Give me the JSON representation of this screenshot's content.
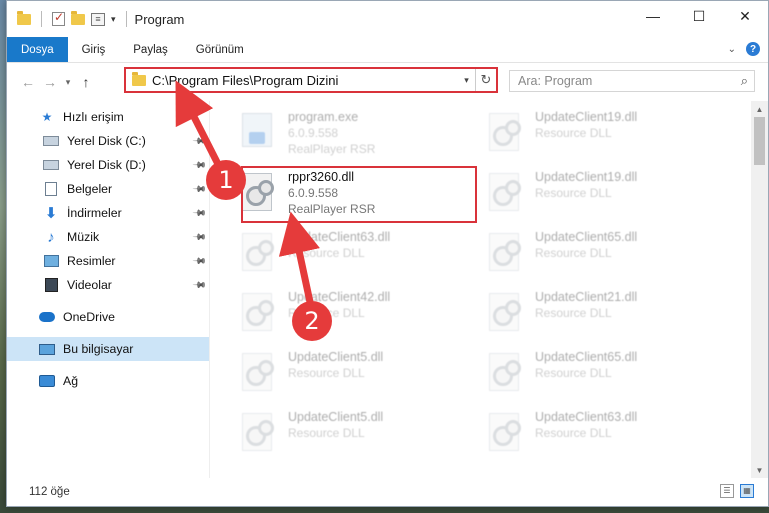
{
  "window": {
    "title": "Program",
    "controls": {
      "minimize": "—",
      "maximize": "☐",
      "close": "✕"
    }
  },
  "ribbon": {
    "tabs": [
      "Dosya",
      "Giriş",
      "Paylaş",
      "Görünüm"
    ]
  },
  "address": {
    "path": "C:\\Program Files\\Program Dizini",
    "search_placeholder": "Ara: Program"
  },
  "nav": {
    "quick_access": "Hızlı erişim",
    "items": [
      {
        "label": "Yerel Disk (C:)",
        "icon": "drive-icon",
        "pinned": true
      },
      {
        "label": "Yerel Disk (D:)",
        "icon": "drive-icon",
        "pinned": true
      },
      {
        "label": "Belgeler",
        "icon": "documents-icon",
        "pinned": true
      },
      {
        "label": "İndirmeler",
        "icon": "downloads-icon",
        "pinned": true
      },
      {
        "label": "Müzik",
        "icon": "music-icon",
        "pinned": true
      },
      {
        "label": "Resimler",
        "icon": "pictures-icon",
        "pinned": true
      },
      {
        "label": "Videolar",
        "icon": "videos-icon",
        "pinned": true
      }
    ],
    "onedrive": "OneDrive",
    "this_pc": "Bu bilgisayar",
    "network": "Ağ"
  },
  "files": [
    {
      "name": "program.exe",
      "line2": "6.0.9.558",
      "line3": "RealPlayer RSR",
      "type": "exe",
      "col": 0,
      "row": 0,
      "faded": true
    },
    {
      "name": "rppr3260.dll",
      "line2": "6.0.9.558",
      "line3": "RealPlayer RSR",
      "type": "dll",
      "col": 0,
      "row": 1,
      "faded": false
    },
    {
      "name": "UpdateClient63.dll",
      "line2": "Resource DLL",
      "type": "dll",
      "col": 0,
      "row": 2,
      "faded": true
    },
    {
      "name": "UpdateClient42.dll",
      "line2": "Resource DLL",
      "type": "dll",
      "col": 0,
      "row": 3,
      "faded": true
    },
    {
      "name": "UpdateClient5.dll",
      "line2": "Resource DLL",
      "type": "dll",
      "col": 0,
      "row": 4,
      "faded": true
    },
    {
      "name": "UpdateClient5.dll",
      "line2": "Resource DLL",
      "type": "dll",
      "col": 0,
      "row": 5,
      "faded": true
    },
    {
      "name": "UpdateClient19.dll",
      "line2": "Resource DLL",
      "type": "dll",
      "col": 1,
      "row": 0,
      "faded": true
    },
    {
      "name": "UpdateClient19.dll",
      "line2": "Resource DLL",
      "type": "dll",
      "col": 1,
      "row": 1,
      "faded": true
    },
    {
      "name": "UpdateClient65.dll",
      "line2": "Resource DLL",
      "type": "dll",
      "col": 1,
      "row": 2,
      "faded": true
    },
    {
      "name": "UpdateClient21.dll",
      "line2": "Resource DLL",
      "type": "dll",
      "col": 1,
      "row": 3,
      "faded": true
    },
    {
      "name": "UpdateClient65.dll",
      "line2": "Resource DLL",
      "type": "dll",
      "col": 1,
      "row": 4,
      "faded": true
    },
    {
      "name": "UpdateClient63.dll",
      "line2": "Resource DLL",
      "type": "dll",
      "col": 1,
      "row": 5,
      "faded": true
    }
  ],
  "status": {
    "item_count": "112 öğe"
  },
  "annotations": {
    "step1": "1",
    "step2": "2",
    "accent": "#e53b3b"
  }
}
